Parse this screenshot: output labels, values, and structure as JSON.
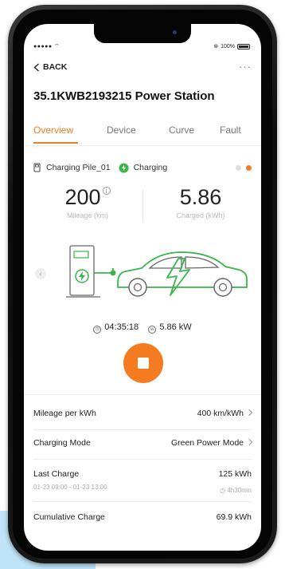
{
  "status": {
    "signal": "●●●●● ",
    "battery_pct": "100%"
  },
  "nav": {
    "back_label": "BACK",
    "more": "···"
  },
  "page_title": "35.1KWB2193215 Power Station",
  "tabs": [
    {
      "label": "Overview",
      "active": true
    },
    {
      "label": "Device",
      "active": false
    },
    {
      "label": "Curve",
      "active": false
    },
    {
      "label": "Fault",
      "active": false
    }
  ],
  "pile": {
    "name": "Charging Pile_01",
    "status": "Charging"
  },
  "stats": {
    "mileage": {
      "value": "200",
      "label": "Mileage (km)"
    },
    "charged": {
      "value": "5.86",
      "label": "Charged (kWh)"
    }
  },
  "session": {
    "time": "04:35:18",
    "power": "5.86 kW"
  },
  "details": [
    {
      "label": "Mileage per kWh",
      "value": "400 km/kWh"
    },
    {
      "label": "Charging Mode",
      "value": "Green Power Mode"
    },
    {
      "label": "Last Charge",
      "value": "125 kWh",
      "sub": "01-23 09:00 - 01-23 13:00",
      "sub_value": "4h30min"
    },
    {
      "label": "Cumulative Charge",
      "value": "69.9 kWh"
    }
  ],
  "colors": {
    "accent": "#f07e25",
    "green": "#39b54a"
  }
}
